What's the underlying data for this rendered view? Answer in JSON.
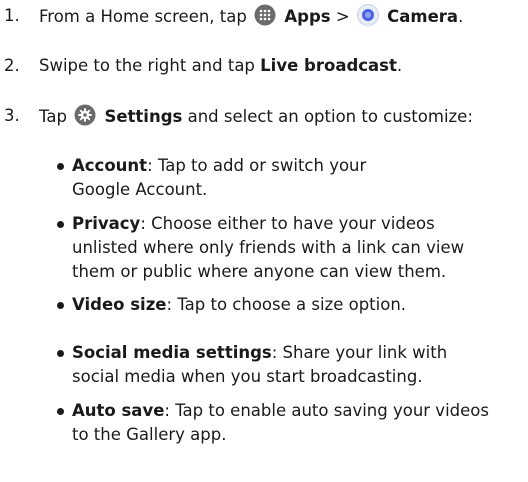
{
  "steps": [
    {
      "num": "1.",
      "pre": "From a Home screen, tap",
      "apps_label": "Apps",
      "separator": ">",
      "camera_label": "Camera",
      "end": "."
    },
    {
      "num": "2.",
      "pre": "Swipe to the right and tap",
      "bold": "Live broadcast",
      "end": "."
    },
    {
      "num": "3.",
      "pre": "Tap",
      "bold": "Settings",
      "post": "and select an option to customize:"
    }
  ],
  "options": [
    {
      "term": "Account",
      "lines": [
        ": Tap to add or switch your",
        "Google Account."
      ]
    },
    {
      "term": "Privacy",
      "lines": [
        ": Choose either to have your videos",
        "unlisted where only friends with a link can view",
        "them or public where anyone can view them."
      ]
    },
    {
      "term": "Video size",
      "lines": [
        ": Tap to choose a size option."
      ]
    },
    {
      "term": "Social media settings",
      "lines": [
        ": Share your link with",
        "social media when you start broadcasting."
      ]
    },
    {
      "term": "Auto save",
      "lines": [
        ": Tap to enable auto saving your videos",
        "to the Gallery app."
      ]
    }
  ],
  "icons": {
    "apps": "apps-grid-icon",
    "camera": "camera-icon",
    "settings": "settings-gear-icon"
  },
  "colors": {
    "text": "#1a1a1a",
    "icon_gray": "#6b6b6b",
    "camera_blue": "#4a63e0"
  }
}
